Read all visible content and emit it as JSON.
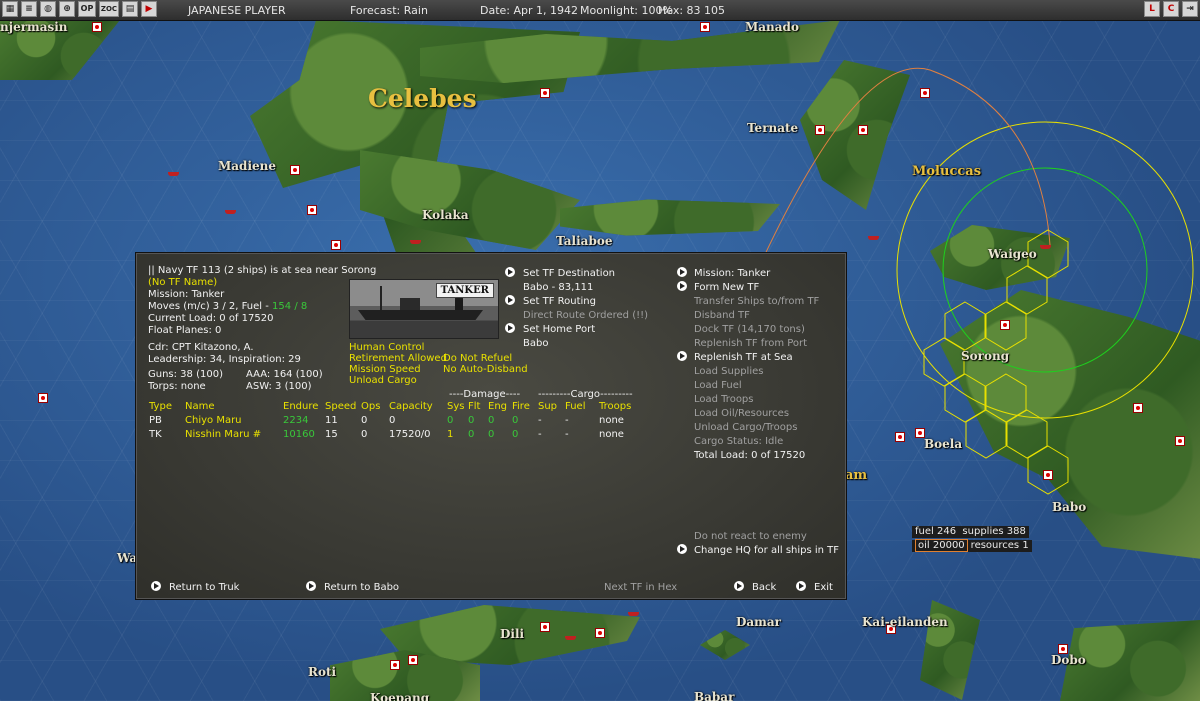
{
  "topbar": {
    "player": "JAPANESE PLAYER",
    "forecast": "Forecast: Rain",
    "date": "Date: Apr 1, 1942",
    "moonlight": "Moonlight: 100%",
    "hex": "Hex: 83 105",
    "left_buttons": [
      "OP",
      "ZOC"
    ],
    "right_buttons": [
      "L",
      "C"
    ]
  },
  "map": {
    "labels": {
      "celebes": "Celebes",
      "manado": "Manado",
      "ternate": "Ternate",
      "moluccas": "Moluccas",
      "madiene": "Madiene",
      "kolaka": "Kolaka",
      "taliaboe": "Taliaboe",
      "waigeo": "Waigeo",
      "sorong": "Sorong",
      "boela": "Boela",
      "babo": "Babo",
      "banjermasin": "njermasin",
      "dili": "Dili",
      "damar": "Damar",
      "kai": "Kai-eilanden",
      "dobo": "Dobo",
      "roti": "Roti",
      "koepang": "Koepang",
      "babar": "Babar",
      "wa": "Wa",
      "am": "am"
    },
    "info_box": {
      "fuel": "fuel 246",
      "supplies": "supplies 388",
      "oil": "oil 20000",
      "resources": "resources 1"
    }
  },
  "dialog": {
    "header": "|| Navy TF 113 (2 ships) is at sea near Sorong",
    "tf_name": "(No TF Name)",
    "mission": "Mission: Tanker",
    "moves": "Moves (m/c) 3 / 2, Fuel - ",
    "fuel_value": "154 / 8",
    "current_load": "Current Load: 0 of 17520",
    "float_planes": "Float Planes: 0",
    "cdr": "Cdr: CPT Kitazono, A.",
    "leadership": "Leadership: 34, Inspiration: 29",
    "guns": "Guns: 38 (100)",
    "aaa": "AAA: 164 (100)",
    "torps": "Torps: none",
    "asw": "ASW: 3 (100)",
    "ship_image_label": "TANKER",
    "options": {
      "human_control": "Human Control",
      "retirement": "Retirement Allowed",
      "no_refuel": "Do Not Refuel",
      "mission_speed": "Mission Speed",
      "no_disband": "No Auto-Disband",
      "unload_cargo": "Unload Cargo"
    },
    "destination": {
      "set_dest": "Set TF Destination",
      "dest_value": "Babo - 83,111",
      "set_routing": "Set TF Routing",
      "routing_value": "Direct Route Ordered (!!)",
      "set_home": "Set Home Port",
      "home_value": "Babo"
    },
    "right_menu": [
      {
        "label": "Mission: Tanker",
        "active": true,
        "arrow": true
      },
      {
        "label": "Form New TF",
        "active": true,
        "arrow": true
      },
      {
        "label": "Transfer Ships to/from TF",
        "active": false,
        "arrow": false
      },
      {
        "label": "Disband TF",
        "active": false,
        "arrow": false
      },
      {
        "label": "Dock TF (14,170 tons)",
        "active": false,
        "arrow": false
      },
      {
        "label": "Replenish TF from Port",
        "active": false,
        "arrow": false
      },
      {
        "label": "Replenish TF at Sea",
        "active": true,
        "arrow": true
      },
      {
        "label": "Load Supplies",
        "active": false,
        "arrow": false
      },
      {
        "label": "Load Fuel",
        "active": false,
        "arrow": false
      },
      {
        "label": "Load Troops",
        "active": false,
        "arrow": false
      },
      {
        "label": "Load Oil/Resources",
        "active": false,
        "arrow": false
      },
      {
        "label": "Unload Cargo/Troops",
        "active": false,
        "arrow": false
      },
      {
        "label": "Cargo Status: Idle",
        "active": false,
        "arrow": false
      },
      {
        "label": "Total Load: 0 of 17520",
        "active": true,
        "arrow": false
      }
    ],
    "group_headers": {
      "damage": "----Damage----",
      "cargo": "---------Cargo---------"
    },
    "columns": [
      "Type",
      "Name",
      "Endure",
      "Speed",
      "Ops",
      "Capacity",
      "Sys",
      "Flt",
      "Eng",
      "Fire",
      "Sup",
      "Fuel",
      "Troops"
    ],
    "rows": [
      [
        "PB",
        "Chiyo Maru",
        "2234",
        "11",
        "0",
        "0",
        "0",
        "0",
        "0",
        "0",
        "-",
        "-",
        "none"
      ],
      [
        "TK",
        "Nisshin Maru #",
        "10160",
        "15",
        "0",
        "17520/0",
        "1",
        "0",
        "0",
        "0",
        "-",
        "-",
        "none"
      ]
    ],
    "do_not_react": "Do not react to enemy",
    "change_hq": "Change HQ for all ships in TF",
    "footer": {
      "return_truk": "Return to Truk",
      "return_babo": "Return to Babo",
      "next_tf": "Next TF in Hex",
      "back": "Back",
      "exit": "Exit"
    }
  }
}
